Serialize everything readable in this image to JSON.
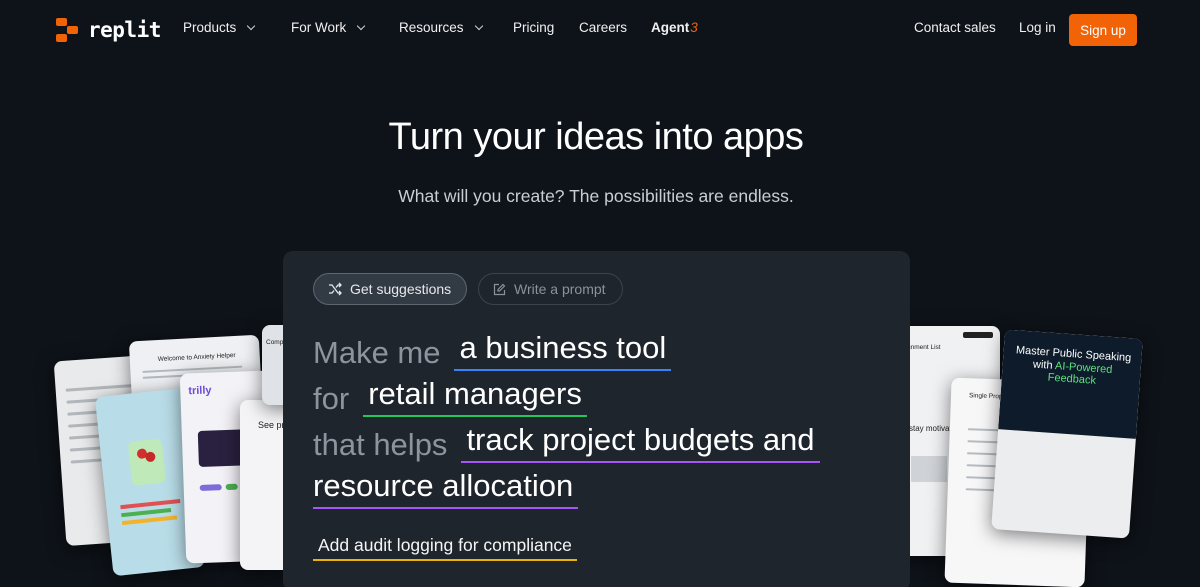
{
  "nav": {
    "logo_text": "replit",
    "items": [
      {
        "label": "Products",
        "has_dropdown": true
      },
      {
        "label": "For Work",
        "has_dropdown": true
      },
      {
        "label": "Resources",
        "has_dropdown": true
      },
      {
        "label": "Pricing",
        "has_dropdown": false
      },
      {
        "label": "Careers",
        "has_dropdown": false
      }
    ],
    "agent_label": "Agent",
    "agent_version": "3",
    "contact_sales": "Contact sales",
    "login": "Log in",
    "signup": "Sign up"
  },
  "hero": {
    "title": "Turn your ideas into apps",
    "subtitle": "What will you create? The possibilities are endless."
  },
  "prompt_panel": {
    "tabs": [
      {
        "label": "Get suggestions",
        "icon": "shuffle-icon",
        "active": true
      },
      {
        "label": "Write a prompt",
        "icon": "edit-icon",
        "active": false
      }
    ],
    "lines": [
      {
        "static": "Make me",
        "fill": "a business tool",
        "color": "#3b82f6"
      },
      {
        "static": "for",
        "fill": "retail managers",
        "color": "#22c55e"
      },
      {
        "static": "that helps",
        "fill": "track project budgets and",
        "color": "#a855f7"
      },
      {
        "static": "",
        "fill": "resource allocation",
        "color": "#a855f7"
      }
    ],
    "addon": "Add audit logging for compliance"
  },
  "preview_cards": {
    "assistant_title": "Welcome to Anxiety Helper",
    "trilly_title": "trilly",
    "see_text": "See pr",
    "comp_text": "Comp",
    "assignment_text": "gnment List",
    "stay_text": "stay motivated",
    "property_text": "Single Property Loan Calculator",
    "speaking_title": "Master Public Speaking with",
    "speaking_highlight": "AI-Powered",
    "speaking_tail": "Feedback"
  },
  "colors": {
    "accent": "#f26207",
    "background": "#0e1319",
    "panel": "#1f252d"
  }
}
